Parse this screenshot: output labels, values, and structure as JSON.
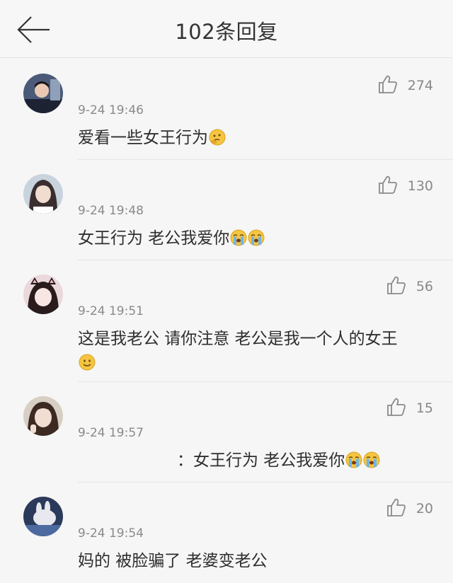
{
  "header": {
    "title": "102条回复"
  },
  "comments": [
    {
      "likes": "274",
      "time": "9-24 19:46",
      "text": "爱看一些女王行为",
      "emojis": [
        "thinking-face"
      ],
      "avatar": "avatar-1"
    },
    {
      "likes": "130",
      "time": "9-24 19:48",
      "text": "女王行为 老公我爱你",
      "emojis": [
        "crying-face",
        "crying-face"
      ],
      "avatar": "avatar-2"
    },
    {
      "likes": "56",
      "time": "9-24 19:51",
      "text": "这是我老公 请你注意 老公是我一个人的女王",
      "emojis": [
        "smiling-face"
      ],
      "avatar": "avatar-3"
    },
    {
      "likes": "15",
      "time": "9-24 19:57",
      "text": "：女王行为 老公我爱你",
      "emojis": [
        "crying-face",
        "crying-face"
      ],
      "avatar": "avatar-4"
    },
    {
      "likes": "20",
      "time": "9-24 19:54",
      "text": "妈的 被脸骗了 老婆变老公",
      "emojis": [],
      "avatar": "avatar-5"
    }
  ]
}
